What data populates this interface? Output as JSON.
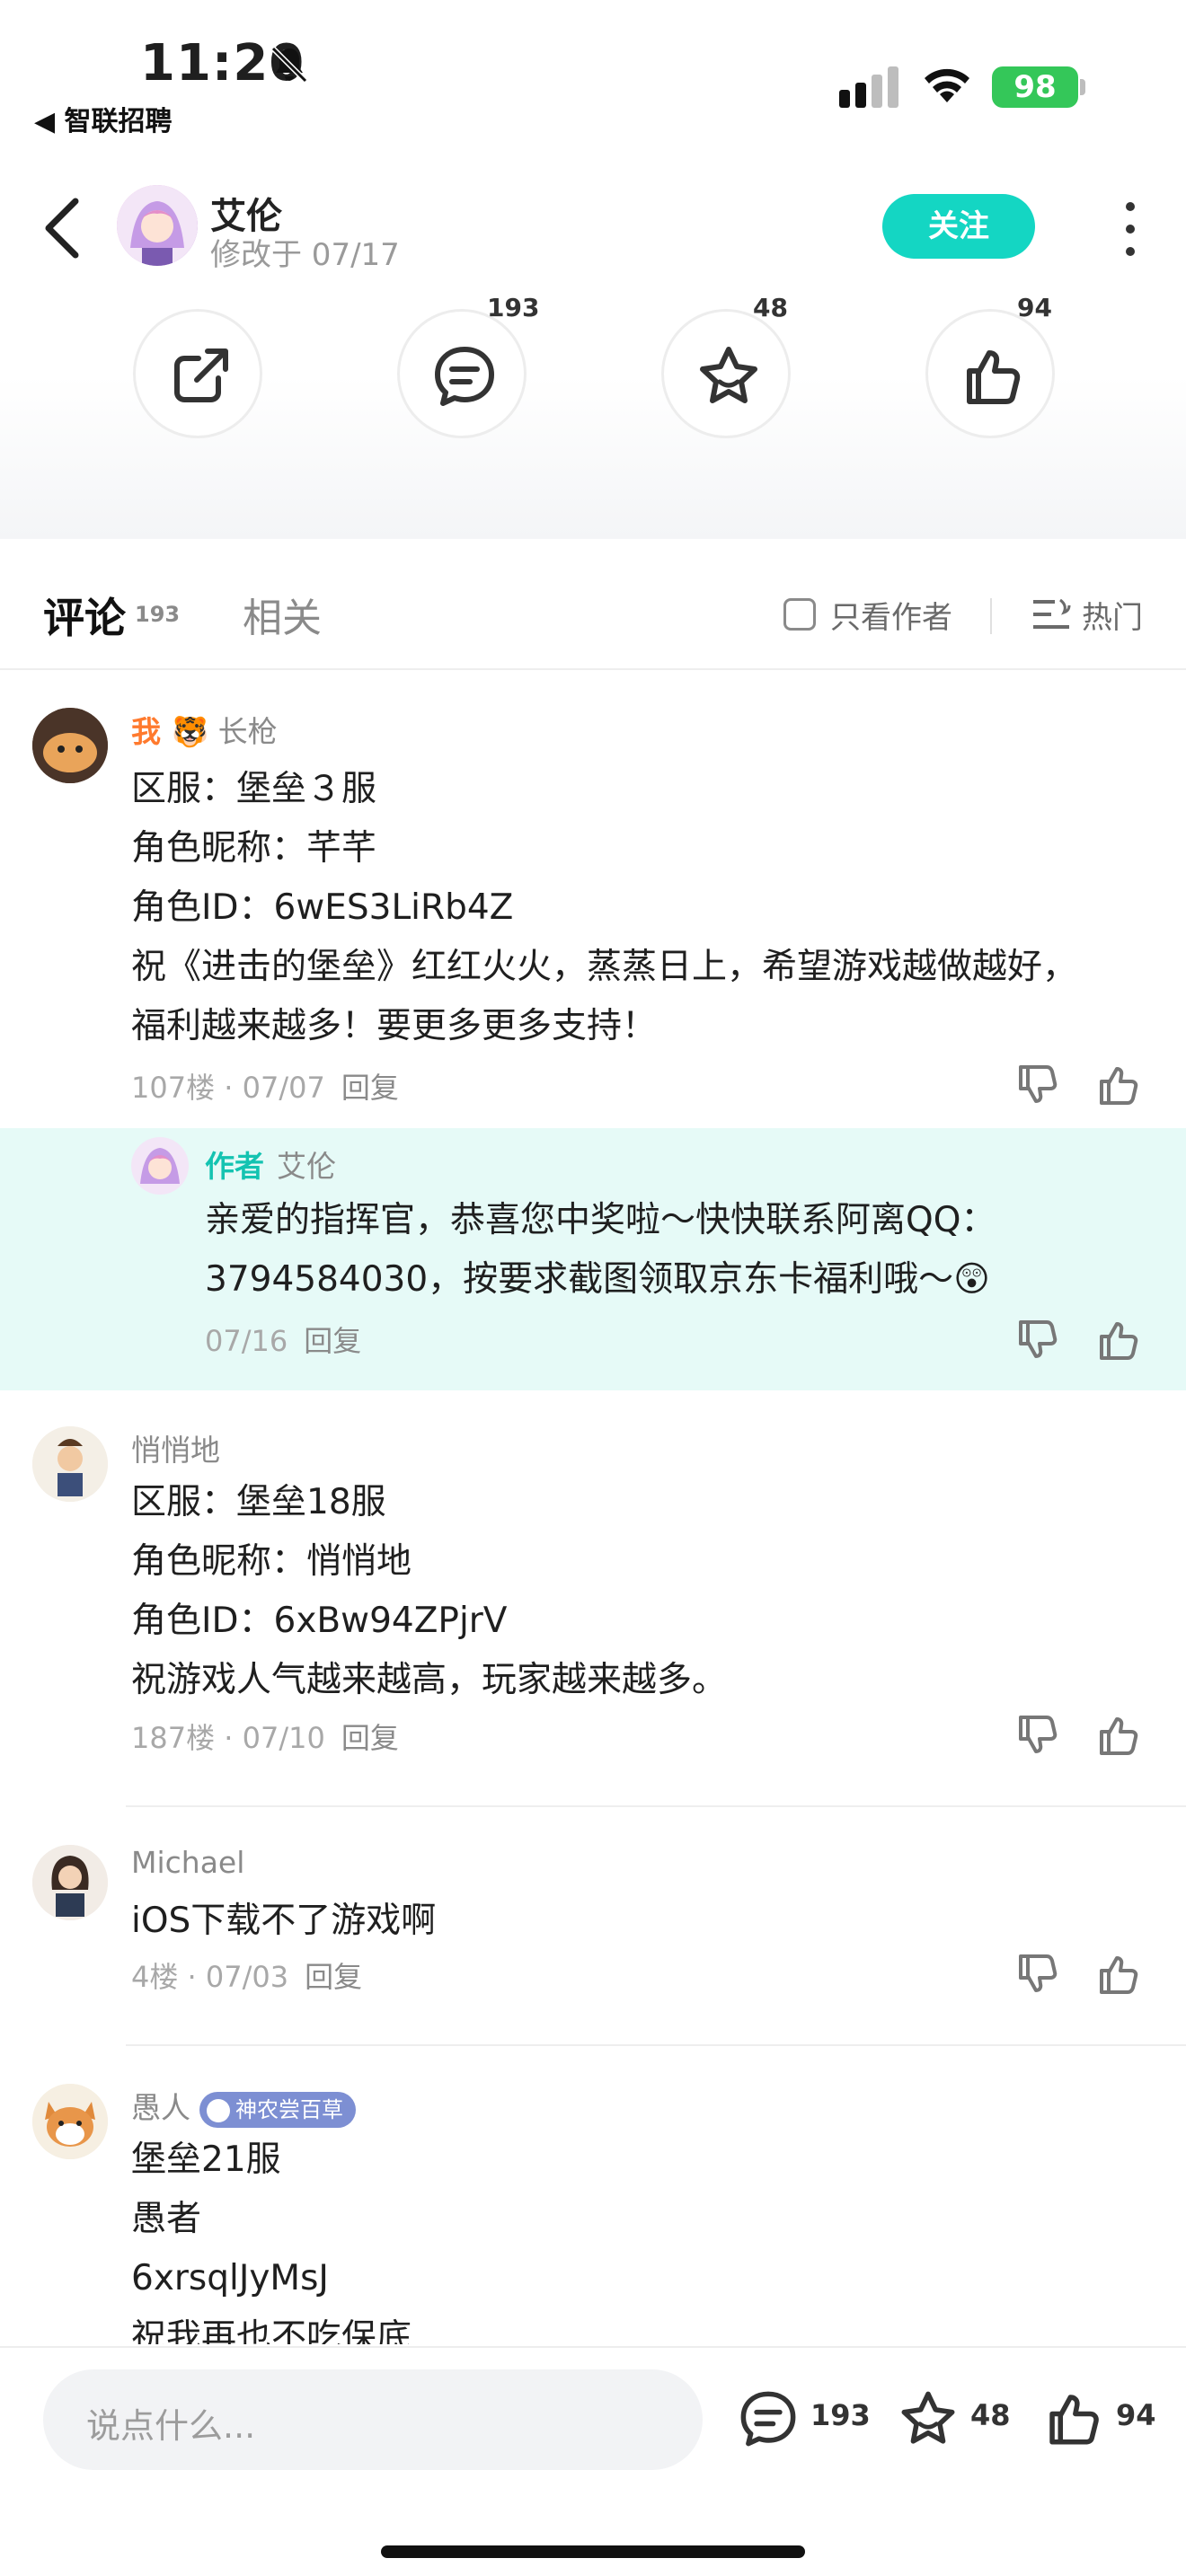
{
  "status": {
    "time": "11:20",
    "back_app": "◀ 智联招聘",
    "battery": "98"
  },
  "header": {
    "name": "艾伦",
    "date": "修改于 07/17",
    "follow_label": "关注"
  },
  "actions": {
    "comments": "193",
    "stars": "48",
    "likes": "94"
  },
  "tabs": {
    "comment_label": "评论",
    "comment_count": "193",
    "related_label": "相关",
    "author_only": "只看作者",
    "sort": "热门"
  },
  "comments": [
    {
      "me": "我",
      "name": "长枪",
      "lines": [
        "区服：堡垒３服",
        "角色昵称：芊芊",
        "角色ID：6wES3LiRb4Z",
        "祝《进击的堡垒》红红火火，蒸蒸日上，希望游戏越做越好，",
        "福利越来越多！要更多更多支持！"
      ],
      "floor": "107楼 · 07/07",
      "reply": "回复",
      "author_reply": {
        "tag": "作者",
        "name": "艾伦",
        "lines": [
          "亲爱的指挥官，恭喜您中奖啦～快快联系阿离QQ：",
          "3794584030，按要求截图领取京东卡福利哦～😲"
        ],
        "date": "07/16",
        "reply": "回复"
      }
    },
    {
      "name": "悄悄地",
      "lines": [
        "区服：堡垒18服",
        "角色昵称：悄悄地",
        "角色ID：6xBw94ZPjrV",
        "祝游戏人气越来越高，玩家越来越多。"
      ],
      "floor": "187楼 · 07/10",
      "reply": "回复"
    },
    {
      "name": "Michael",
      "lines": [
        "iOS下载不了游戏啊"
      ],
      "floor": "4楼 · 07/03",
      "reply": "回复"
    },
    {
      "name": "愚人",
      "badge": "神农尝百草",
      "lines": [
        "堡垒21服",
        "愚者",
        "6xrsqlJyMsJ",
        "祝我再也不吃保底"
      ]
    }
  ],
  "bottom": {
    "placeholder": "说点什么...",
    "comments": "193",
    "stars": "48",
    "likes": "94"
  },
  "colors": {
    "accent": "#14d6c3",
    "me": "#ff7a2e",
    "reply_bg": "#e6faf7"
  }
}
